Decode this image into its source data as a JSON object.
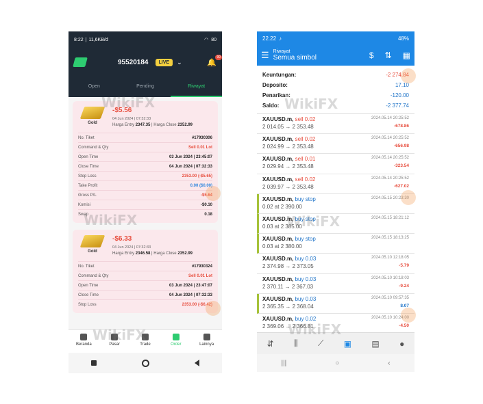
{
  "left": {
    "status": {
      "time": "8:22",
      "network": "11,6KB/d",
      "battery": "80"
    },
    "header": {
      "account": "95520184",
      "mode": "LIVE",
      "notifications": "99"
    },
    "tabs": [
      "Open",
      "Pending",
      "Riwayat"
    ],
    "cards": [
      {
        "symbol": "Gold",
        "profit": "-$5.56",
        "date": "04 Jun 2024 | 07:32:33",
        "entry_label": "Harga Entry",
        "entry": "2347.35",
        "close_label": "Harga Close",
        "close": "2352.99",
        "rows": [
          {
            "label": "No. Tiket",
            "value": "#17930306"
          },
          {
            "label": "Command & Qty",
            "value": "Sell 0.01 Lot"
          },
          {
            "label": "Open Time",
            "value": "03 Jun 2024 | 23:45:07"
          },
          {
            "label": "Close Time",
            "value": "04 Jun 2024 | 07:32:33"
          },
          {
            "label": "Stop Loss",
            "value": "2353.00 (-$5.65)"
          },
          {
            "label": "Take Profit",
            "value": "0.00 ($0.00)"
          },
          {
            "label": "Gross P/L",
            "value": "-$5.64"
          },
          {
            "label": "Komisi",
            "value": "-$0.10"
          },
          {
            "label": "Swap",
            "value": "0.18"
          }
        ]
      },
      {
        "symbol": "Gold",
        "profit": "-$6.33",
        "date": "04 Jun 2024 | 07:32:33",
        "entry_label": "Harga Entry",
        "entry": "2346.58",
        "close_label": "Harga Close",
        "close": "2352.99",
        "rows": [
          {
            "label": "No. Tiket",
            "value": "#17930324"
          },
          {
            "label": "Command & Qty",
            "value": "Sell 0.01 Lot"
          },
          {
            "label": "Open Time",
            "value": "03 Jun 2024 | 23:47:07"
          },
          {
            "label": "Close Time",
            "value": "04 Jun 2024 | 07:32:33"
          },
          {
            "label": "Stop Loss",
            "value": "2353.00 (-$6.42)"
          }
        ]
      }
    ],
    "nav": [
      "Beranda",
      "Pasar",
      "Trade",
      "Order",
      "Lainnya"
    ]
  },
  "right": {
    "status": {
      "time": "22.22",
      "battery": "48%"
    },
    "header": {
      "small": "Riwayat",
      "big": "Semua simbol"
    },
    "summary": [
      {
        "label": "Keuntungan:",
        "value": "-2 274.84"
      },
      {
        "label": "Deposito:",
        "value": "17.10"
      },
      {
        "label": "Penarikan:",
        "value": "-120.00"
      },
      {
        "label": "Saldo:",
        "value": "-2 377.74"
      }
    ],
    "items": [
      {
        "symbol": "XAUUSD.m,",
        "action": "sell 0.02",
        "time": "2024.05.14 20:25:52",
        "prices": "2 014.05 → 2 353.48",
        "pl": "-678.86"
      },
      {
        "symbol": "XAUUSD.m,",
        "action": "sell 0.02",
        "time": "2024.05.14 20:25:52",
        "prices": "2 024.99 → 2 353.48",
        "pl": "-656.98"
      },
      {
        "symbol": "XAUUSD.m,",
        "action": "sell 0.01",
        "time": "2024.05.14 20:25:52",
        "prices": "2 029.94 → 2 353.48",
        "pl": "-323.54"
      },
      {
        "symbol": "XAUUSD.m,",
        "action": "sell 0.02",
        "time": "2024.05.14 20:25:52",
        "prices": "2 039.97 → 2 353.48",
        "pl": "-627.02"
      },
      {
        "symbol": "XAUUSD.m,",
        "action": "buy stop",
        "time": "2024.05.15 20:23:30",
        "prices": "0.02 at 2 390.00",
        "pl": ""
      },
      {
        "symbol": "XAUUSD.m,",
        "action": "buy stop",
        "time": "2024.05.15 18:21:12",
        "prices": "0.03 at 2 385.00",
        "pl": ""
      },
      {
        "symbol": "XAUUSD.m,",
        "action": "buy stop",
        "time": "2024.05.15 18:13:25",
        "prices": "0.03 at 2 380.00",
        "pl": ""
      },
      {
        "symbol": "XAUUSD.m,",
        "action": "buy 0.03",
        "time": "2024.05.10 12:18:05",
        "prices": "2 374.98 → 2 373.05",
        "pl": "-5.79"
      },
      {
        "symbol": "XAUUSD.m,",
        "action": "buy 0.03",
        "time": "2024.05.10 10:18:03",
        "prices": "2 370.11 → 2 367.03",
        "pl": "-9.24"
      },
      {
        "symbol": "XAUUSD.m,",
        "action": "buy 0.03",
        "time": "2024.05.10 09:57:35",
        "prices": "2 365.35 → 2 368.04",
        "pl": "8.07"
      },
      {
        "symbol": "XAUUSD.m,",
        "action": "buy 0.02",
        "time": "2024.05.10 10:24:00",
        "prices": "2 369.06 → 2 366.81",
        "pl": "-4.50"
      }
    ]
  },
  "watermark": "WikiFX"
}
